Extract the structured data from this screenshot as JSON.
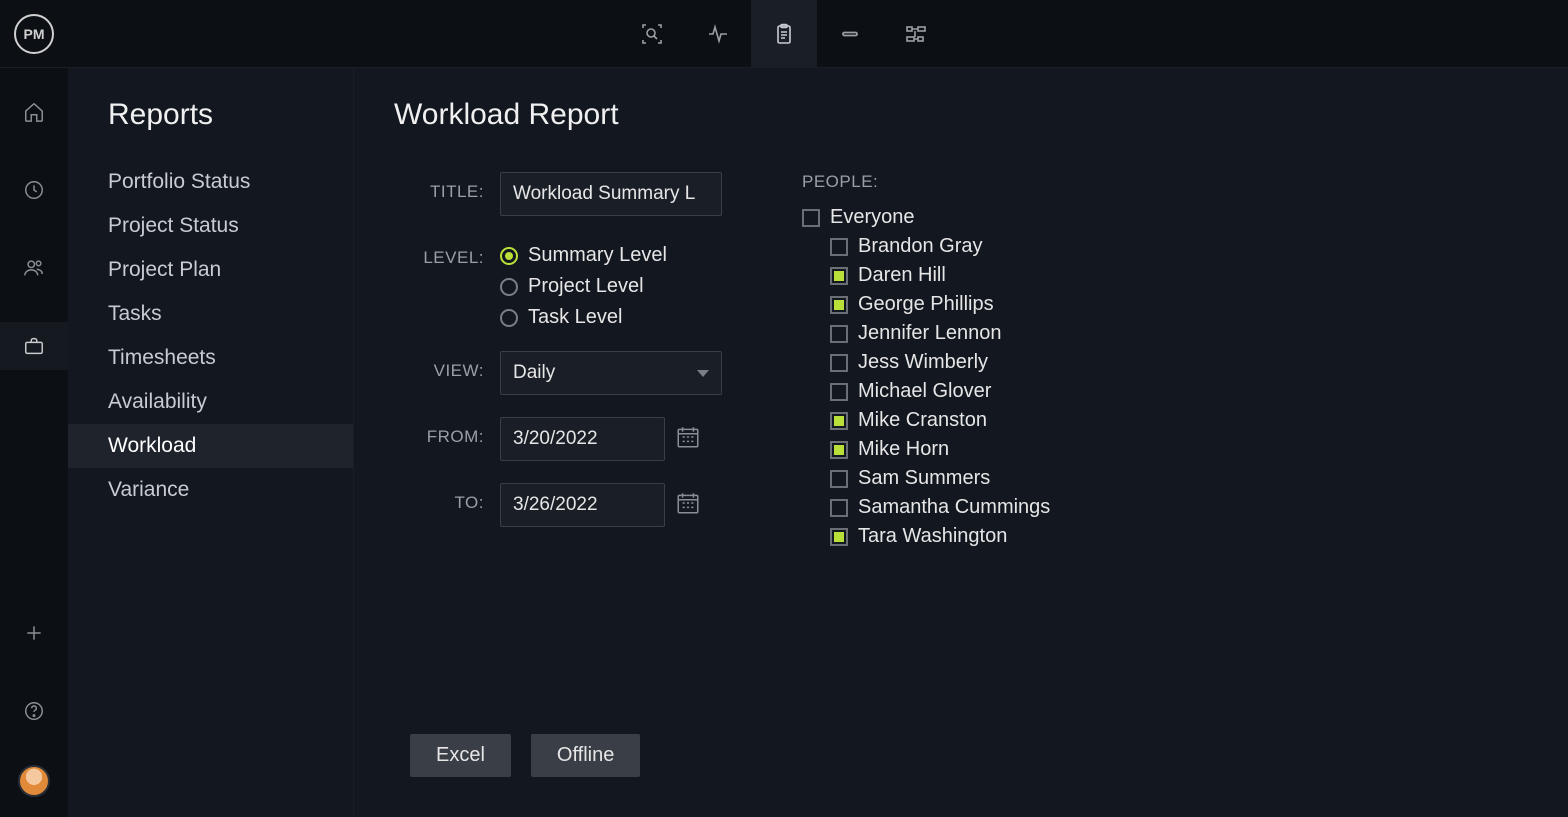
{
  "logo": "PM",
  "sidebar": {
    "title": "Reports",
    "items": [
      {
        "label": "Portfolio Status",
        "active": false
      },
      {
        "label": "Project Status",
        "active": false
      },
      {
        "label": "Project Plan",
        "active": false
      },
      {
        "label": "Tasks",
        "active": false
      },
      {
        "label": "Timesheets",
        "active": false
      },
      {
        "label": "Availability",
        "active": false
      },
      {
        "label": "Workload",
        "active": true
      },
      {
        "label": "Variance",
        "active": false
      }
    ]
  },
  "content": {
    "title": "Workload Report",
    "labels": {
      "title": "TITLE:",
      "level": "LEVEL:",
      "view": "VIEW:",
      "from": "FROM:",
      "to": "TO:",
      "people": "PEOPLE:"
    },
    "title_value": "Workload Summary L",
    "level_options": [
      {
        "label": "Summary Level",
        "selected": true
      },
      {
        "label": "Project Level",
        "selected": false
      },
      {
        "label": "Task Level",
        "selected": false
      }
    ],
    "view_value": "Daily",
    "from_value": "3/20/2022",
    "to_value": "3/26/2022",
    "people": {
      "everyone_label": "Everyone",
      "everyone_checked": false,
      "list": [
        {
          "name": "Brandon Gray",
          "checked": false
        },
        {
          "name": "Daren Hill",
          "checked": true
        },
        {
          "name": "George Phillips",
          "checked": true
        },
        {
          "name": "Jennifer Lennon",
          "checked": false
        },
        {
          "name": "Jess Wimberly",
          "checked": false
        },
        {
          "name": "Michael Glover",
          "checked": false
        },
        {
          "name": "Mike Cranston",
          "checked": true
        },
        {
          "name": "Mike Horn",
          "checked": true
        },
        {
          "name": "Sam Summers",
          "checked": false
        },
        {
          "name": "Samantha Cummings",
          "checked": false
        },
        {
          "name": "Tara Washington",
          "checked": true
        }
      ]
    },
    "buttons": {
      "excel": "Excel",
      "offline": "Offline"
    }
  }
}
